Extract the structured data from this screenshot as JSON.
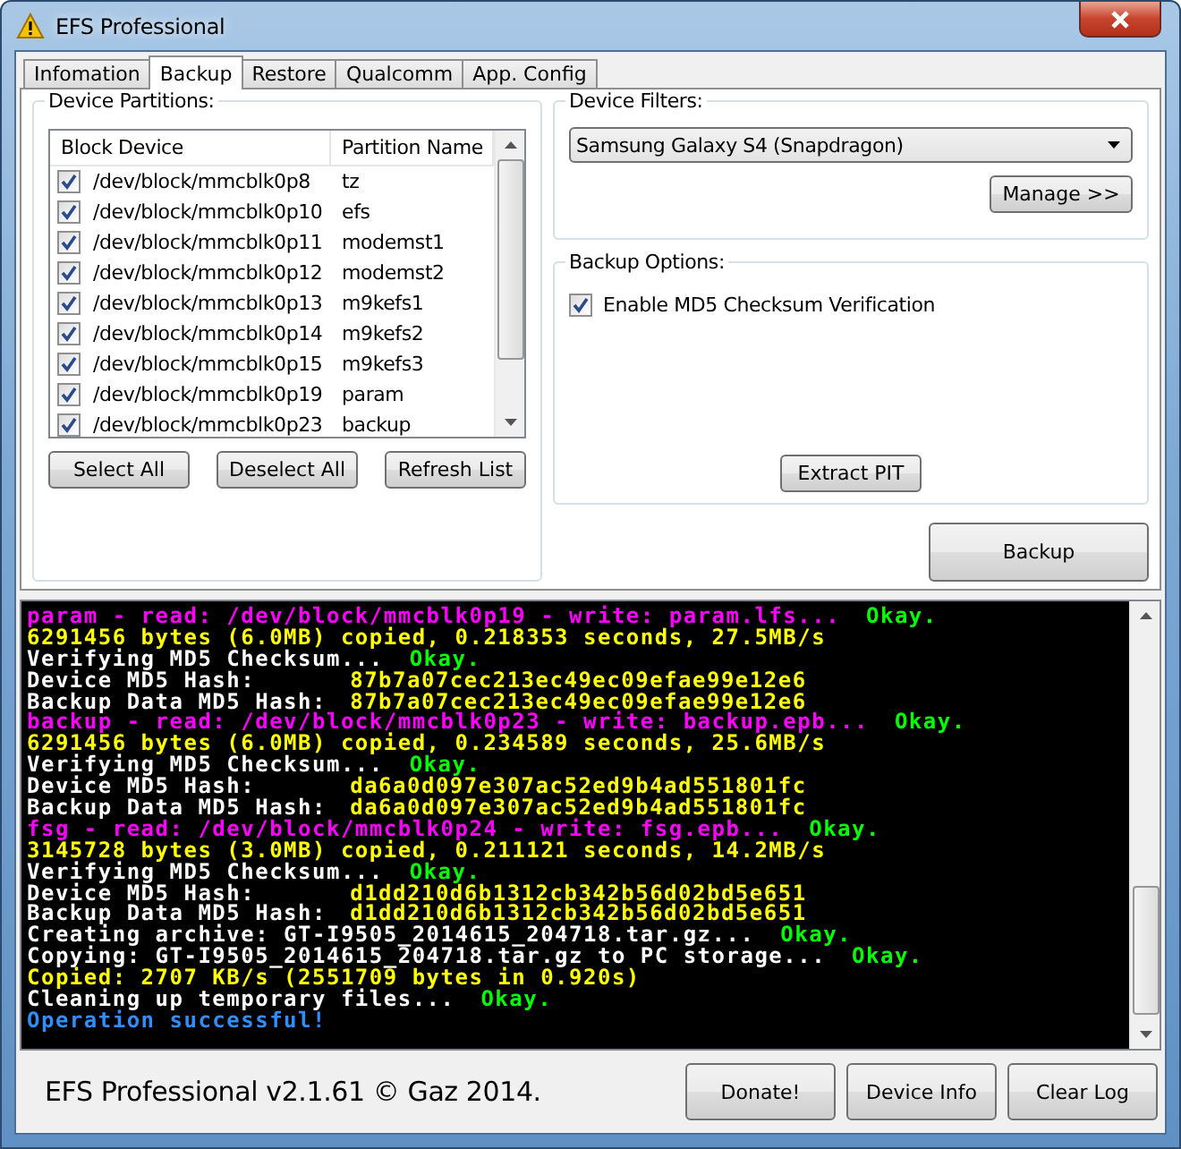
{
  "window": {
    "title": "EFS Professional"
  },
  "tabs": [
    {
      "label": "Infomation",
      "selected": false
    },
    {
      "label": "Backup",
      "selected": true
    },
    {
      "label": "Restore",
      "selected": false
    },
    {
      "label": "Qualcomm",
      "selected": false
    },
    {
      "label": "App. Config",
      "selected": false
    }
  ],
  "partitions": {
    "title": "Device Partitions:",
    "columns": [
      "Block Device",
      "Partition Name"
    ],
    "rows": [
      {
        "device": "/dev/block/mmcblk0p8",
        "name": "tz",
        "checked": true
      },
      {
        "device": "/dev/block/mmcblk0p10",
        "name": "efs",
        "checked": true
      },
      {
        "device": "/dev/block/mmcblk0p11",
        "name": "modemst1",
        "checked": true
      },
      {
        "device": "/dev/block/mmcblk0p12",
        "name": "modemst2",
        "checked": true
      },
      {
        "device": "/dev/block/mmcblk0p13",
        "name": "m9kefs1",
        "checked": true
      },
      {
        "device": "/dev/block/mmcblk0p14",
        "name": "m9kefs2",
        "checked": true
      },
      {
        "device": "/dev/block/mmcblk0p15",
        "name": "m9kefs3",
        "checked": true
      },
      {
        "device": "/dev/block/mmcblk0p19",
        "name": "param",
        "checked": true
      },
      {
        "device": "/dev/block/mmcblk0p23",
        "name": "backup",
        "checked": true
      }
    ],
    "buttons": [
      "Select All",
      "Deselect All",
      "Refresh List"
    ]
  },
  "device_filters": {
    "title": "Device Filters:",
    "value": "Samsung Galaxy S4 (Snapdragon)",
    "button": "Manage >>"
  },
  "backup_options": {
    "title": "Backup Options:",
    "options": [
      {
        "label": "Enable MD5 Checksum Verification",
        "checked": true
      }
    ],
    "button": "Extract PIT"
  },
  "backup_button": "Backup",
  "log": [
    {
      "kind": "plain",
      "segments": [
        {
          "text": "param - read: /dev/block/mmcblk0p19 - write: param.lfs...",
          "color": "#ff00ff"
        },
        {
          "text": "Okay.",
          "color": "#00ff00"
        }
      ]
    },
    {
      "kind": "plain",
      "segments": [
        {
          "text": "6291456 bytes (6.0MB) copied, 0.218353 seconds, 27.5MB/s",
          "color": "#ffff00"
        }
      ]
    },
    {
      "kind": "plain",
      "segments": [
        {
          "text": "Verifying MD5 Checksum...",
          "color": "#ffffff"
        },
        {
          "text": "Okay.",
          "color": "#00ff00"
        }
      ]
    },
    {
      "kind": "field",
      "segments": [
        {
          "text": "Device MD5 Hash:",
          "color": "#ffffff"
        },
        {
          "text": "87b7a07cec213ec49ec09efae99e12e6",
          "color": "#ffff00"
        }
      ]
    },
    {
      "kind": "field",
      "segments": [
        {
          "text": "Backup Data MD5 Hash:",
          "color": "#ffffff"
        },
        {
          "text": "87b7a07cec213ec49ec09efae99e12e6",
          "color": "#ffff00"
        }
      ]
    },
    {
      "kind": "plain",
      "segments": [
        {
          "text": "backup - read: /dev/block/mmcblk0p23 - write: backup.epb...",
          "color": "#ff00ff"
        },
        {
          "text": "Okay.",
          "color": "#00ff00"
        }
      ]
    },
    {
      "kind": "plain",
      "segments": [
        {
          "text": "6291456 bytes (6.0MB) copied, 0.234589 seconds, 25.6MB/s",
          "color": "#ffff00"
        }
      ]
    },
    {
      "kind": "plain",
      "segments": [
        {
          "text": "Verifying MD5 Checksum...",
          "color": "#ffffff"
        },
        {
          "text": "Okay.",
          "color": "#00ff00"
        }
      ]
    },
    {
      "kind": "field",
      "segments": [
        {
          "text": "Device MD5 Hash:",
          "color": "#ffffff"
        },
        {
          "text": "da6a0d097e307ac52ed9b4ad551801fc",
          "color": "#ffff00"
        }
      ]
    },
    {
      "kind": "field",
      "segments": [
        {
          "text": "Backup Data MD5 Hash:",
          "color": "#ffffff"
        },
        {
          "text": "da6a0d097e307ac52ed9b4ad551801fc",
          "color": "#ffff00"
        }
      ]
    },
    {
      "kind": "plain",
      "segments": [
        {
          "text": "fsg - read: /dev/block/mmcblk0p24 - write: fsg.epb...",
          "color": "#ff00ff"
        },
        {
          "text": "Okay.",
          "color": "#00ff00"
        }
      ]
    },
    {
      "kind": "plain",
      "segments": [
        {
          "text": "3145728 bytes (3.0MB) copied, 0.211121 seconds, 14.2MB/s",
          "color": "#ffff00"
        }
      ]
    },
    {
      "kind": "plain",
      "segments": [
        {
          "text": "Verifying MD5 Checksum...",
          "color": "#ffffff"
        },
        {
          "text": "Okay.",
          "color": "#00ff00"
        }
      ]
    },
    {
      "kind": "field",
      "segments": [
        {
          "text": "Device MD5 Hash:",
          "color": "#ffffff"
        },
        {
          "text": "d1dd210d6b1312cb342b56d02bd5e651",
          "color": "#ffff00"
        }
      ]
    },
    {
      "kind": "field",
      "segments": [
        {
          "text": "Backup Data MD5 Hash:",
          "color": "#ffffff"
        },
        {
          "text": "d1dd210d6b1312cb342b56d02bd5e651",
          "color": "#ffff00"
        }
      ]
    },
    {
      "kind": "plain",
      "segments": [
        {
          "text": "Creating archive: GT-I9505_2014615_204718.tar.gz...",
          "color": "#ffffff"
        },
        {
          "text": "Okay.",
          "color": "#00ff00"
        }
      ]
    },
    {
      "kind": "plain",
      "segments": [
        {
          "text": "Copying: GT-I9505_2014615_204718.tar.gz to PC storage...",
          "color": "#ffffff"
        },
        {
          "text": "Okay.",
          "color": "#00ff00"
        }
      ]
    },
    {
      "kind": "plain",
      "segments": [
        {
          "text": "Copied: 2707 KB/s (2551709 bytes in 0.920s)",
          "color": "#ffff00"
        }
      ]
    },
    {
      "kind": "plain",
      "segments": [
        {
          "text": "Cleaning up temporary files...",
          "color": "#ffffff"
        },
        {
          "text": "Okay.",
          "color": "#00ff00"
        }
      ]
    },
    {
      "kind": "plain",
      "segments": [
        {
          "text": "Operation successful!",
          "color": "#2f8fff"
        }
      ]
    }
  ],
  "footer": {
    "text": "EFS Professional v2.1.61 © Gaz 2014.",
    "buttons": [
      "Donate!",
      "Device Info",
      "Clear Log"
    ]
  }
}
